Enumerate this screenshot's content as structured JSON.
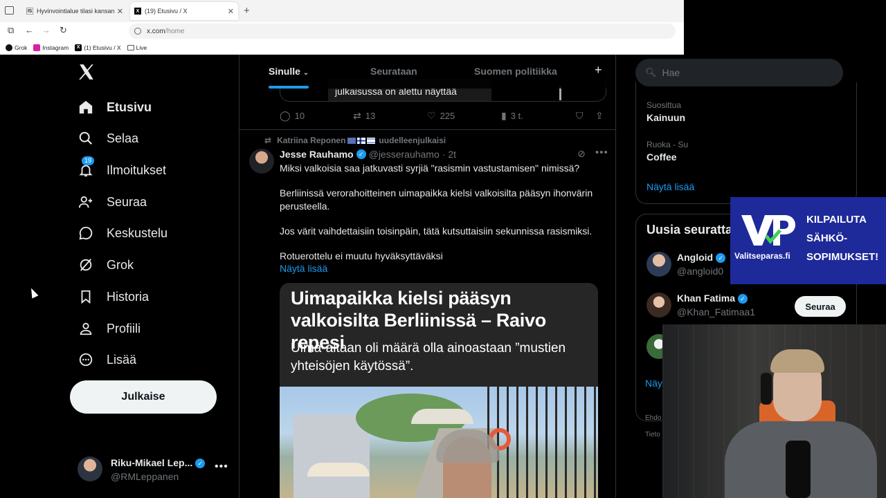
{
  "browser": {
    "tabs": [
      {
        "icon": "is-favicon",
        "label": "Hyvinvointialue tilasi kansanedu",
        "active": false
      },
      {
        "icon": "x-favicon",
        "label": "(19) Etusivu / X",
        "active": true
      }
    ],
    "url_host": "x.com",
    "url_path": "/home",
    "bookmarks": [
      {
        "icon": "grok-icon",
        "label": "Grok"
      },
      {
        "icon": "instagram-icon",
        "label": "Instagram"
      },
      {
        "icon": "x-icon",
        "label": "(1) Etusivu / X"
      },
      {
        "icon": "folder-icon",
        "label": "Live"
      }
    ]
  },
  "sidebar": {
    "items": [
      {
        "label": "Etusivu",
        "icon": "home-icon"
      },
      {
        "label": "Selaa",
        "icon": "search-icon"
      },
      {
        "label": "Ilmoitukset",
        "icon": "bell-icon",
        "badge": "19"
      },
      {
        "label": "Seuraa",
        "icon": "add-user-icon"
      },
      {
        "label": "Keskustelu",
        "icon": "chat-icon"
      },
      {
        "label": "Grok",
        "icon": "grok-icon"
      },
      {
        "label": "Historia",
        "icon": "bookmark-icon"
      },
      {
        "label": "Profiili",
        "icon": "profile-icon"
      },
      {
        "label": "Lisää",
        "icon": "more-icon"
      }
    ],
    "post_button": "Julkaise",
    "account": {
      "name": "Riku-Mikael Lep...",
      "handle": "@RMLeppanen"
    }
  },
  "timeline": {
    "tabs": [
      {
        "label": "Sinulle",
        "active": true
      },
      {
        "label": "Seurataan",
        "active": false
      },
      {
        "label": "Suomen politiikka",
        "active": false
      }
    ],
    "previous_post": {
      "card_text": "julkaisussa on alettu näyttää",
      "replies": "10",
      "reposts": "13",
      "likes": "225",
      "views": "3 t."
    },
    "post": {
      "reposted_by": "Katriina Reponen",
      "repost_suffix": "uudelleenjulkaisi",
      "author_name": "Jesse Rauhamo",
      "author_handle": "@jesserauhamo",
      "time": "· 2t",
      "paragraphs": [
        "Miksi valkoisia saa jatkuvasti syrjiä \"rasismin vastustamisen\" nimissä?",
        "Berliinissä verorahoitteinen uimapaikka kielsi valkoisilta pääsyn ihonvärin perusteella.",
        "Jos värit vaihdettaisiin toisinpäin, tätä kutsuttaisiin sekunnissa rasismiksi.",
        "Rotuerottelu ei muutu hyväksyttäväksi"
      ],
      "show_more": "Näytä lisää",
      "article_title": "Uimapaikka kielsi pääsyn valkoisilta Berliinissä – Raivo repesi",
      "article_subtitle": "Uima-altaan oli määrä olla ainoastaan ”mustien yhteisöjen käytössä”."
    }
  },
  "right": {
    "search_placeholder": "Hae",
    "trends": [
      {
        "category": "Suosittua",
        "name": "Kainuun"
      },
      {
        "category": "Ruoka - Su",
        "name": "Coffee"
      }
    ],
    "show_more": "Näytä lisää",
    "who_to_follow_title": "Uusia seuratta",
    "who_to_follow": [
      {
        "name": "Angloid",
        "handle": "@angloid0"
      },
      {
        "name": "Khan Fatima",
        "handle": "@Khan_Fatimaa1",
        "button": "Seuraa"
      }
    ],
    "show_more_2": "Näy",
    "footer_1": "Ehdo",
    "footer_2": "Tieto"
  },
  "ad": {
    "domain": "Valitseparas.fi",
    "lines": [
      "KILPAILUTA",
      "SÄHKÖ-",
      "SOPIMUKSET!"
    ],
    "brand_color": "#1e2a9a"
  },
  "colors": {
    "accent": "#1d9bf0",
    "background": "#000000",
    "text": "#e7e9ea",
    "muted": "#71767b",
    "border": "#2f3336"
  }
}
